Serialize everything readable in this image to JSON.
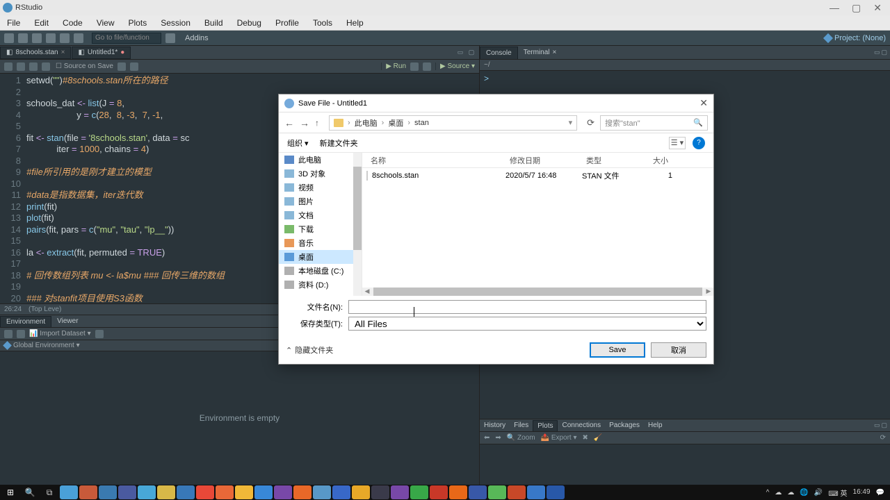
{
  "window": {
    "title": "RStudio"
  },
  "menu": [
    "File",
    "Edit",
    "Code",
    "View",
    "Plots",
    "Session",
    "Build",
    "Debug",
    "Profile",
    "Tools",
    "Help"
  ],
  "toolbar": {
    "goto": "Go to file/function",
    "addins": "Addins",
    "project": "Project: (None)"
  },
  "editor_tabs": [
    {
      "label": "8schools.stan",
      "dirty": false
    },
    {
      "label": "Untitled1*",
      "dirty": true
    }
  ],
  "editor_toolbar": {
    "source_on_save": "Source on Save",
    "run": "Run",
    "source": "Source"
  },
  "code_lines": [
    {
      "n": 1,
      "html": "setwd(<span class='str'>\"\"</span>)<span class='cm2'>#8schools.stan所在的路径</span>"
    },
    {
      "n": 2,
      "html": ""
    },
    {
      "n": 3,
      "html": "schools_dat <span class='op'>&lt;-</span> <span class='fn'>list</span>(J <span class='op'>=</span> <span class='num'>8</span>,"
    },
    {
      "n": 4,
      "html": "                    y <span class='op'>=</span> <span class='fn'>c</span>(<span class='num'>28</span>,  <span class='num'>8</span>, <span class='num'>-3</span>,  <span class='num'>7</span>, <span class='num'>-1</span>,"
    },
    {
      "n": 5,
      "html": ""
    },
    {
      "n": 6,
      "html": "fit <span class='op'>&lt;-</span> <span class='fn'>stan</span>(file <span class='op'>=</span> <span class='str'>'8schools.stan'</span>, data <span class='op'>=</span> sc"
    },
    {
      "n": 7,
      "html": "            iter <span class='op'>=</span> <span class='num'>1000</span>, chains <span class='op'>=</span> <span class='num'>4</span>)"
    },
    {
      "n": 8,
      "html": ""
    },
    {
      "n": 9,
      "html": "<span class='cm'>#file所引用的是刚才建立的模型</span>"
    },
    {
      "n": 10,
      "html": ""
    },
    {
      "n": 11,
      "html": "<span class='cm'>#data是指数据集，iter迭代数</span>"
    },
    {
      "n": 12,
      "html": "<span class='fn'>print</span>(fit)"
    },
    {
      "n": 13,
      "html": "<span class='fn'>plot</span>(fit)"
    },
    {
      "n": 14,
      "html": "<span class='fn'>pairs</span>(fit, pars <span class='op'>=</span> <span class='fn'>c</span>(<span class='str'>\"mu\"</span>, <span class='str'>\"tau\"</span>, <span class='str'>\"lp__\"</span>))"
    },
    {
      "n": 15,
      "html": ""
    },
    {
      "n": 16,
      "html": "la <span class='op'>&lt;-</span> <span class='fn'>extract</span>(fit, permuted <span class='op'>=</span> <span class='kw'>TRUE</span>)"
    },
    {
      "n": 17,
      "html": ""
    },
    {
      "n": 18,
      "html": "<span class='cm'># 回传数组列表 mu &lt;- la$mu ### 回传三维的数组</span>"
    },
    {
      "n": 19,
      "html": ""
    },
    {
      "n": 20,
      "html": "<span class='cm'>### 对stanfit项目使用S3函数</span>"
    }
  ],
  "status": {
    "pos": "26:24",
    "scope": "(Top Leve)"
  },
  "env": {
    "tabs": [
      "Environment",
      "Viewer"
    ],
    "import": "Import Dataset",
    "scope": "Global Environment",
    "empty": "Environment is empty"
  },
  "console": {
    "tabs": [
      "Console",
      "Terminal"
    ],
    "path": "~/",
    "prompt": ">"
  },
  "plots": {
    "tabs": [
      "History",
      "Files",
      "Plots",
      "Connections",
      "Packages",
      "Help"
    ],
    "toolbar": {
      "zoom": "Zoom",
      "export": "Export"
    }
  },
  "dialog": {
    "title": "Save File - Untitled1",
    "breadcrumbs": [
      "此电脑",
      "桌面",
      "stan"
    ],
    "search_placeholder": "搜索\"stan\"",
    "organize": "组织",
    "newfolder": "新建文件夹",
    "tree": [
      {
        "label": "此电脑",
        "icon": "pc"
      },
      {
        "label": "3D 对象",
        "icon": "f3d"
      },
      {
        "label": "视频",
        "icon": "vid"
      },
      {
        "label": "图片",
        "icon": "pic"
      },
      {
        "label": "文档",
        "icon": "doc"
      },
      {
        "label": "下载",
        "icon": "dl"
      },
      {
        "label": "音乐",
        "icon": "mus"
      },
      {
        "label": "桌面",
        "icon": "desk",
        "selected": true
      },
      {
        "label": "本地磁盘 (C:)",
        "icon": "disk"
      },
      {
        "label": "资料 (D:)",
        "icon": "disk"
      }
    ],
    "columns": {
      "name": "名称",
      "date": "修改日期",
      "type": "类型",
      "size": "大小"
    },
    "files": [
      {
        "name": "8schools.stan",
        "date": "2020/5/7 16:48",
        "type": "STAN 文件",
        "size": "1"
      }
    ],
    "filename_label": "文件名(N):",
    "filetype_label": "保存类型(T):",
    "filetype_value": "All Files",
    "filename_value": "",
    "hide_folders": "隐藏文件夹",
    "save": "Save",
    "cancel": "取消"
  },
  "tray": {
    "ime": "英",
    "time": "16:49"
  }
}
